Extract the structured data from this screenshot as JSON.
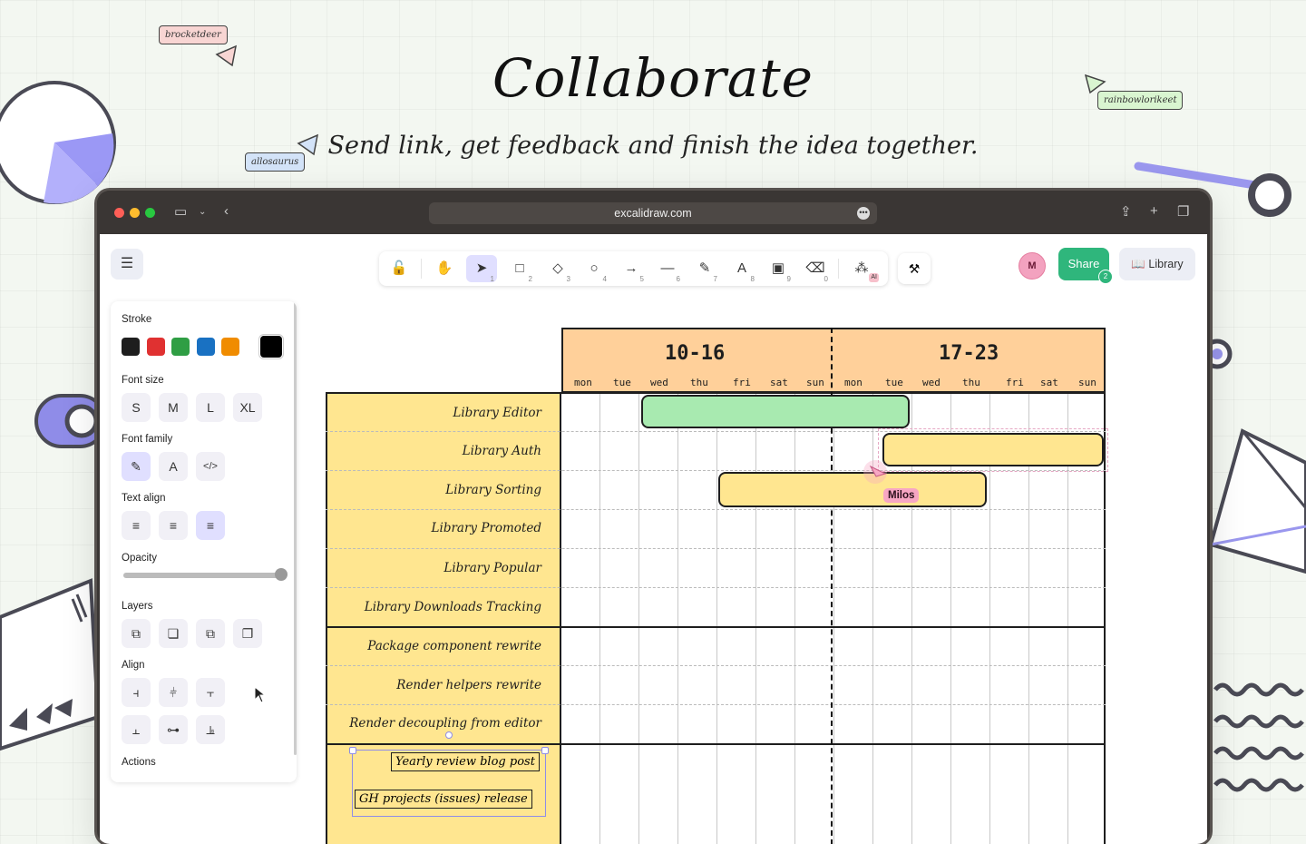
{
  "hero": {
    "title": "Collaborate",
    "subtitle": "Send link, get feedback and finish the idea together."
  },
  "tags": {
    "left_top": "brocketdeer",
    "left_mid": "allosaurus",
    "right_top": "rainbowlorikeet"
  },
  "browser": {
    "url": "excalidraw.com"
  },
  "app": {
    "share_label": "Share",
    "share_count": "2",
    "library_label": "Library",
    "avatar_initial": "M",
    "toolbar": [
      {
        "icon": "lock-icon",
        "glyph": "🔓",
        "key": ""
      },
      {
        "icon": "hand-icon",
        "glyph": "✋",
        "key": ""
      },
      {
        "icon": "selection-icon",
        "glyph": "➤",
        "key": "1"
      },
      {
        "icon": "rectangle-icon",
        "glyph": "□",
        "key": "2"
      },
      {
        "icon": "diamond-icon",
        "glyph": "◇",
        "key": "3"
      },
      {
        "icon": "ellipse-icon",
        "glyph": "○",
        "key": "4"
      },
      {
        "icon": "arrow-icon",
        "glyph": "→",
        "key": "5"
      },
      {
        "icon": "line-icon",
        "glyph": "—",
        "key": "6"
      },
      {
        "icon": "pencil-icon",
        "glyph": "✎",
        "key": "7"
      },
      {
        "icon": "text-icon",
        "glyph": "A",
        "key": "8"
      },
      {
        "icon": "image-icon",
        "glyph": "▣",
        "key": "9"
      },
      {
        "icon": "eraser-icon",
        "glyph": "⌫",
        "key": "0"
      },
      {
        "icon": "more-tools-icon",
        "glyph": "⁂",
        "key": ""
      }
    ],
    "ai_badge": "AI"
  },
  "panel": {
    "stroke_label": "Stroke",
    "stroke_colors": [
      "#1e1e1e",
      "#e03131",
      "#2f9e44",
      "#1971c2",
      "#f08c00"
    ],
    "current_stroke": "#000000",
    "font_size_label": "Font size",
    "font_sizes": [
      "S",
      "M",
      "L",
      "XL"
    ],
    "font_family_label": "Font family",
    "text_align_label": "Text align",
    "opacity_label": "Opacity",
    "opacity_value": 100,
    "layers_label": "Layers",
    "align_label": "Align",
    "actions_label": "Actions"
  },
  "gantt": {
    "weeks": [
      "10-16",
      "17-23"
    ],
    "days": [
      "mon",
      "tue",
      "wed",
      "thu",
      "fri",
      "sat",
      "sun",
      "mon",
      "tue",
      "wed",
      "thu",
      "fri",
      "sat",
      "sun"
    ],
    "tasks": [
      "Library Editor",
      "Library Auth",
      "Library Sorting",
      "Library Promoted",
      "Library Popular",
      "Library Downloads Tracking",
      "Package component rewrite",
      "Render helpers rewrite",
      "Render decoupling from editor",
      "Yearly review blog post",
      "GH projects (issues) release"
    ],
    "cursor_user": "Milos"
  }
}
